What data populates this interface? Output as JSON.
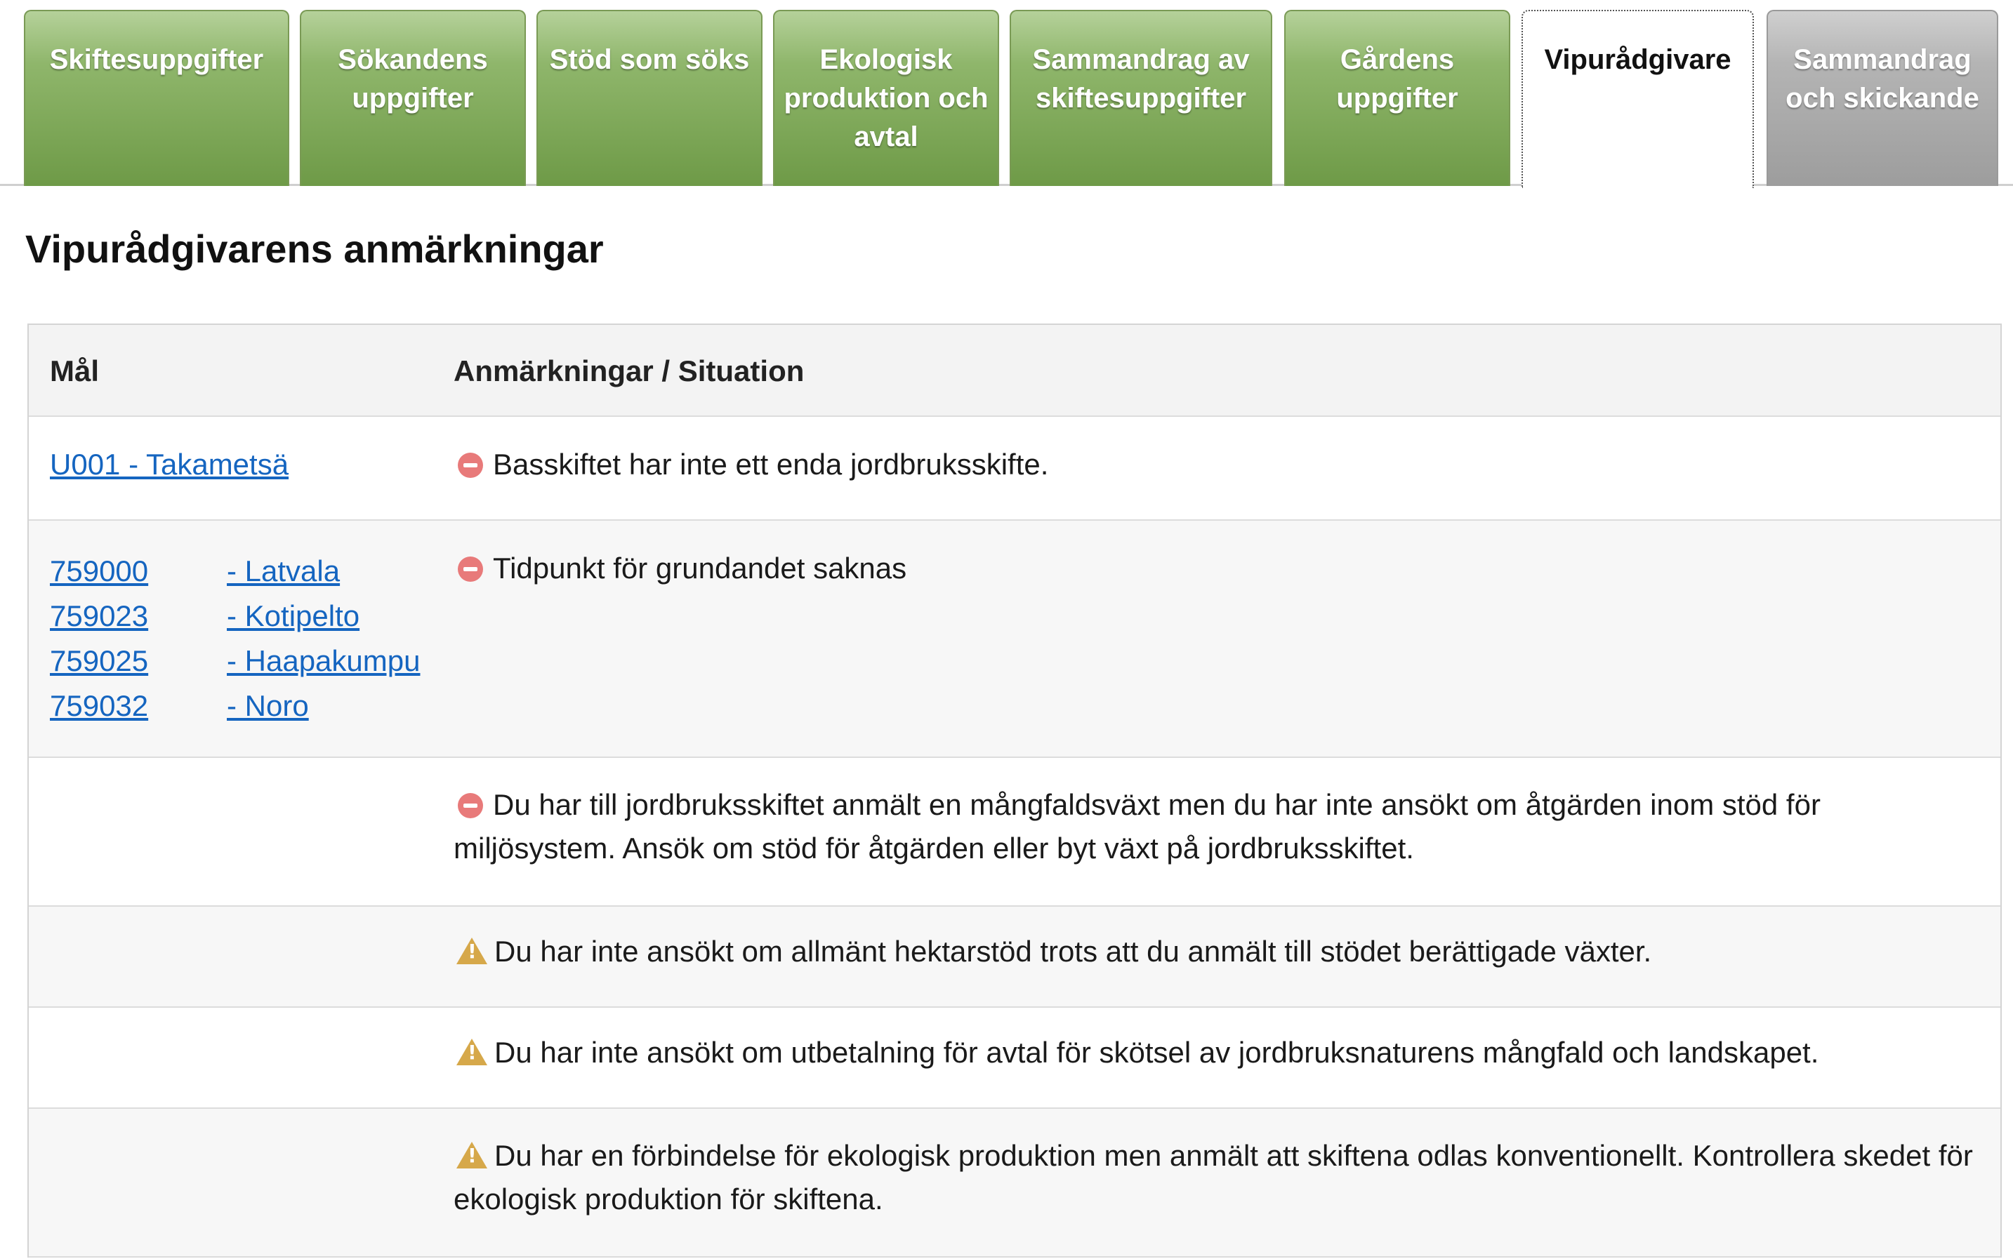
{
  "tabs": [
    {
      "label": "Skiftesuppgifter",
      "state": "normal"
    },
    {
      "label": "Sökandens uppgifter",
      "state": "normal"
    },
    {
      "label": "Stöd som söks",
      "state": "normal"
    },
    {
      "label": "Ekologisk produktion och avtal",
      "state": "normal"
    },
    {
      "label": "Sammandrag av skiftesuppgifter",
      "state": "normal"
    },
    {
      "label": "Gårdens uppgifter",
      "state": "normal"
    },
    {
      "label": "Vipurådgivare",
      "state": "active"
    },
    {
      "label": "Sammandrag och skickande",
      "state": "disabled"
    }
  ],
  "page": {
    "title": "Vipurådgivarens anmärkningar"
  },
  "table": {
    "header": {
      "goal": "Mål",
      "remarks": "Anmärkningar / Situation"
    },
    "rows": [
      {
        "goal_link": "U001 - Takametsä",
        "severity": "error",
        "text": "Basskiftet har inte ett enda jordbruksskifte."
      },
      {
        "parcels": [
          {
            "code": "759000",
            "name": "- Latvala"
          },
          {
            "code": "759023",
            "name": "- Kotipelto"
          },
          {
            "code": "759025",
            "name": "- Haapakumpu"
          },
          {
            "code": "759032",
            "name": "- Noro"
          }
        ],
        "severity": "error",
        "text": "Tidpunkt för grundandet saknas"
      },
      {
        "severity": "error",
        "text": "Du har till jordbruksskiftet anmält en mångfaldsväxt men du har inte ansökt om åtgärden inom stöd för miljösystem. Ansök om stöd för åtgärden eller byt växt på jordbruksskiftet."
      },
      {
        "severity": "warning",
        "text": "Du har inte ansökt om allmänt hektarstöd trots att du anmält till stödet berättigade växter."
      },
      {
        "severity": "warning",
        "text": "Du har inte ansökt om utbetalning för avtal för skötsel av jordbruksnaturens mångfald och landskapet."
      },
      {
        "severity": "warning",
        "text": "Du har en förbindelse för ekologisk produktion men anmält att skiftena odlas konventionellt. Kontrollera skedet för ekologisk produktion för skiftena."
      }
    ]
  },
  "colors": {
    "tab_green": "#6e9a47",
    "tab_disabled": "#9d9d9d",
    "link": "#1565c0",
    "error_icon": "#e87a7a",
    "warning_icon": "#d6a84a"
  }
}
